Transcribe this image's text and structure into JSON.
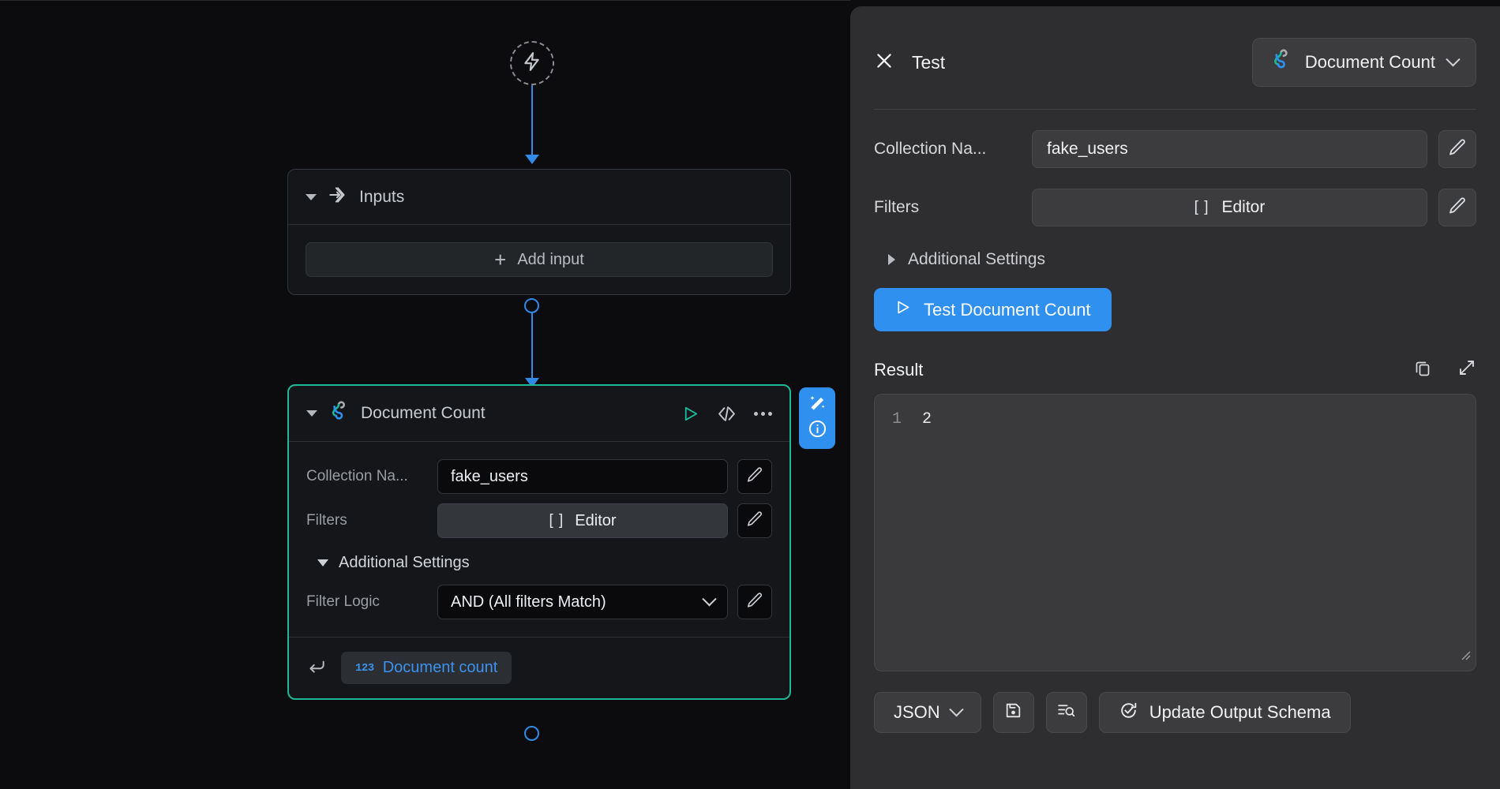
{
  "canvas": {
    "trigger": {
      "icon": "lightning-bolt-icon"
    },
    "inputs_node": {
      "title": "Inputs",
      "icon": "arrow-into-diamond-icon",
      "add_input_label": "Add input"
    },
    "document_count_node": {
      "title": "Document Count",
      "icon": "mongodb-loop-icon",
      "run_icon": "play-icon",
      "code_icon": "code-brackets-icon",
      "more_icon": "ellipsis-icon",
      "fields": [
        {
          "label": "Collection Na...",
          "value": "fake_users",
          "type": "text"
        },
        {
          "label": "Filters",
          "value": "Editor",
          "prefix": "[ ]",
          "type": "editor"
        }
      ],
      "additional_settings_label": "Additional Settings",
      "additional_fields": [
        {
          "label": "Filter Logic",
          "value": "AND (All filters Match)",
          "type": "select"
        }
      ],
      "output": {
        "label": "Document count",
        "type_glyph": "123"
      }
    },
    "magic_panel": {
      "wand_icon": "magic-wand-icon",
      "info_icon": "info-circle-icon"
    }
  },
  "panel": {
    "close_icon": "close-x-icon",
    "title": "Test",
    "node_selector": {
      "label": "Document Count",
      "icon": "mongodb-loop-icon",
      "chevron": "chevron-down-icon"
    },
    "fields": [
      {
        "label": "Collection Na...",
        "value": "fake_users",
        "type": "text"
      },
      {
        "label": "Filters",
        "value": "Editor",
        "prefix": "[ ]",
        "type": "editor"
      }
    ],
    "additional_settings_label": "Additional Settings",
    "test_button": {
      "label": "Test Document Count",
      "icon": "play-icon"
    },
    "result": {
      "label": "Result",
      "copy_icon": "copy-icon",
      "expand_icon": "expand-diagonal-icon",
      "lines": [
        {
          "number": "1",
          "content": "2"
        }
      ]
    },
    "footer": {
      "format_select": {
        "label": "JSON",
        "chevron": "chevron-down-icon"
      },
      "save_icon": "save-file-icon",
      "inspect_icon": "list-search-icon",
      "update_schema": {
        "label": "Update Output Schema",
        "icon": "refresh-check-icon"
      }
    }
  },
  "colors": {
    "accent_blue": "#2f90ef",
    "selected_node_border": "#1fb896",
    "output_chip_text": "#3b92ef",
    "canvas_bg": "#0c0c0e",
    "panel_bg": "#2e2e30"
  }
}
